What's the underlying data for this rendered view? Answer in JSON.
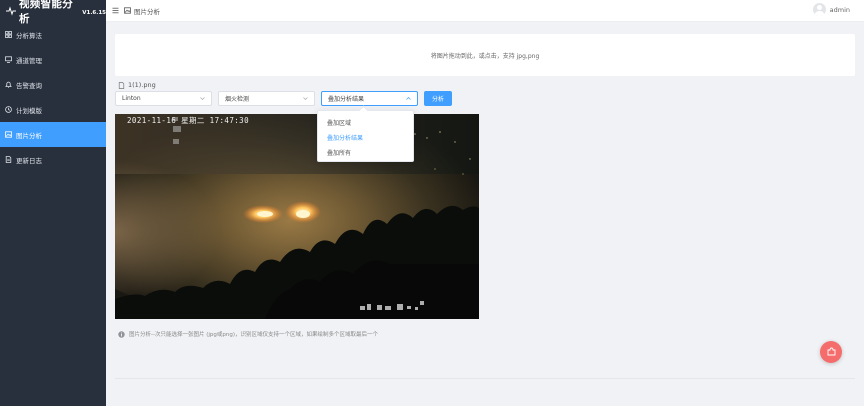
{
  "app": {
    "title": "视频智能分析",
    "version": "V1.6.15"
  },
  "sidebar": {
    "items": [
      {
        "label": "分析算法",
        "icon": "grid-icon",
        "active": false
      },
      {
        "label": "通道管理",
        "icon": "monitor-icon",
        "active": false
      },
      {
        "label": "告警查询",
        "icon": "bell-icon",
        "active": false
      },
      {
        "label": "计划模版",
        "icon": "clock-icon",
        "active": false
      },
      {
        "label": "图片分析",
        "icon": "image-icon",
        "active": true
      },
      {
        "label": "更新日志",
        "icon": "document-icon",
        "active": false
      }
    ]
  },
  "header": {
    "breadcrumb": "图片分析",
    "username": "admin"
  },
  "upload": {
    "hint": "将图片拖动到此，或点击，支持 jpg,png"
  },
  "file": {
    "name": "1(1).png"
  },
  "toolbar": {
    "select_model": "Linton",
    "select_algorithm": "烟火检测",
    "select_overlay": "叠加分析结果",
    "analyze_label": "分析"
  },
  "overlay_options": [
    {
      "label": "叠加区域",
      "selected": false
    },
    {
      "label": "叠加分析结果",
      "selected": true
    },
    {
      "label": "叠加所有",
      "selected": false
    }
  ],
  "photo": {
    "timestamp": "2021-11-16 星期二 17:47:30"
  },
  "note": {
    "text": "图片分析--次只能选择一张图片 (jpg或png)，识别区域仅支持一个区域，如果绘制多个区域取最后一个"
  },
  "colors": {
    "sidebar_bg": "#28303d",
    "accent": "#409eff",
    "fab": "#f56c6c"
  }
}
